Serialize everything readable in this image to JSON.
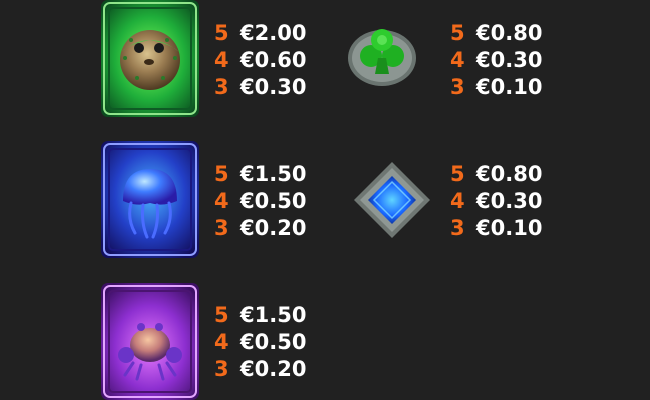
{
  "colors": {
    "background": "#212121",
    "count": "#f26a1b",
    "value": "#ffffff"
  },
  "paytable": [
    {
      "symbol": "pufferfish-symbol",
      "icon": "pufferfish-icon",
      "payouts": [
        {
          "count": "5",
          "value": "€2.00"
        },
        {
          "count": "4",
          "value": "€0.60"
        },
        {
          "count": "3",
          "value": "€0.30"
        }
      ]
    },
    {
      "symbol": "club-symbol",
      "icon": "club-icon",
      "payouts": [
        {
          "count": "5",
          "value": "€0.80"
        },
        {
          "count": "4",
          "value": "€0.30"
        },
        {
          "count": "3",
          "value": "€0.10"
        }
      ]
    },
    {
      "symbol": "jellyfish-symbol",
      "icon": "jellyfish-icon",
      "payouts": [
        {
          "count": "5",
          "value": "€1.50"
        },
        {
          "count": "4",
          "value": "€0.50"
        },
        {
          "count": "3",
          "value": "€0.20"
        }
      ]
    },
    {
      "symbol": "diamond-symbol",
      "icon": "diamond-icon",
      "payouts": [
        {
          "count": "5",
          "value": "€0.80"
        },
        {
          "count": "4",
          "value": "€0.30"
        },
        {
          "count": "3",
          "value": "€0.10"
        }
      ]
    },
    {
      "symbol": "crab-symbol",
      "icon": "crab-icon",
      "payouts": [
        {
          "count": "5",
          "value": "€1.50"
        },
        {
          "count": "4",
          "value": "€0.50"
        },
        {
          "count": "3",
          "value": "€0.20"
        }
      ]
    }
  ]
}
